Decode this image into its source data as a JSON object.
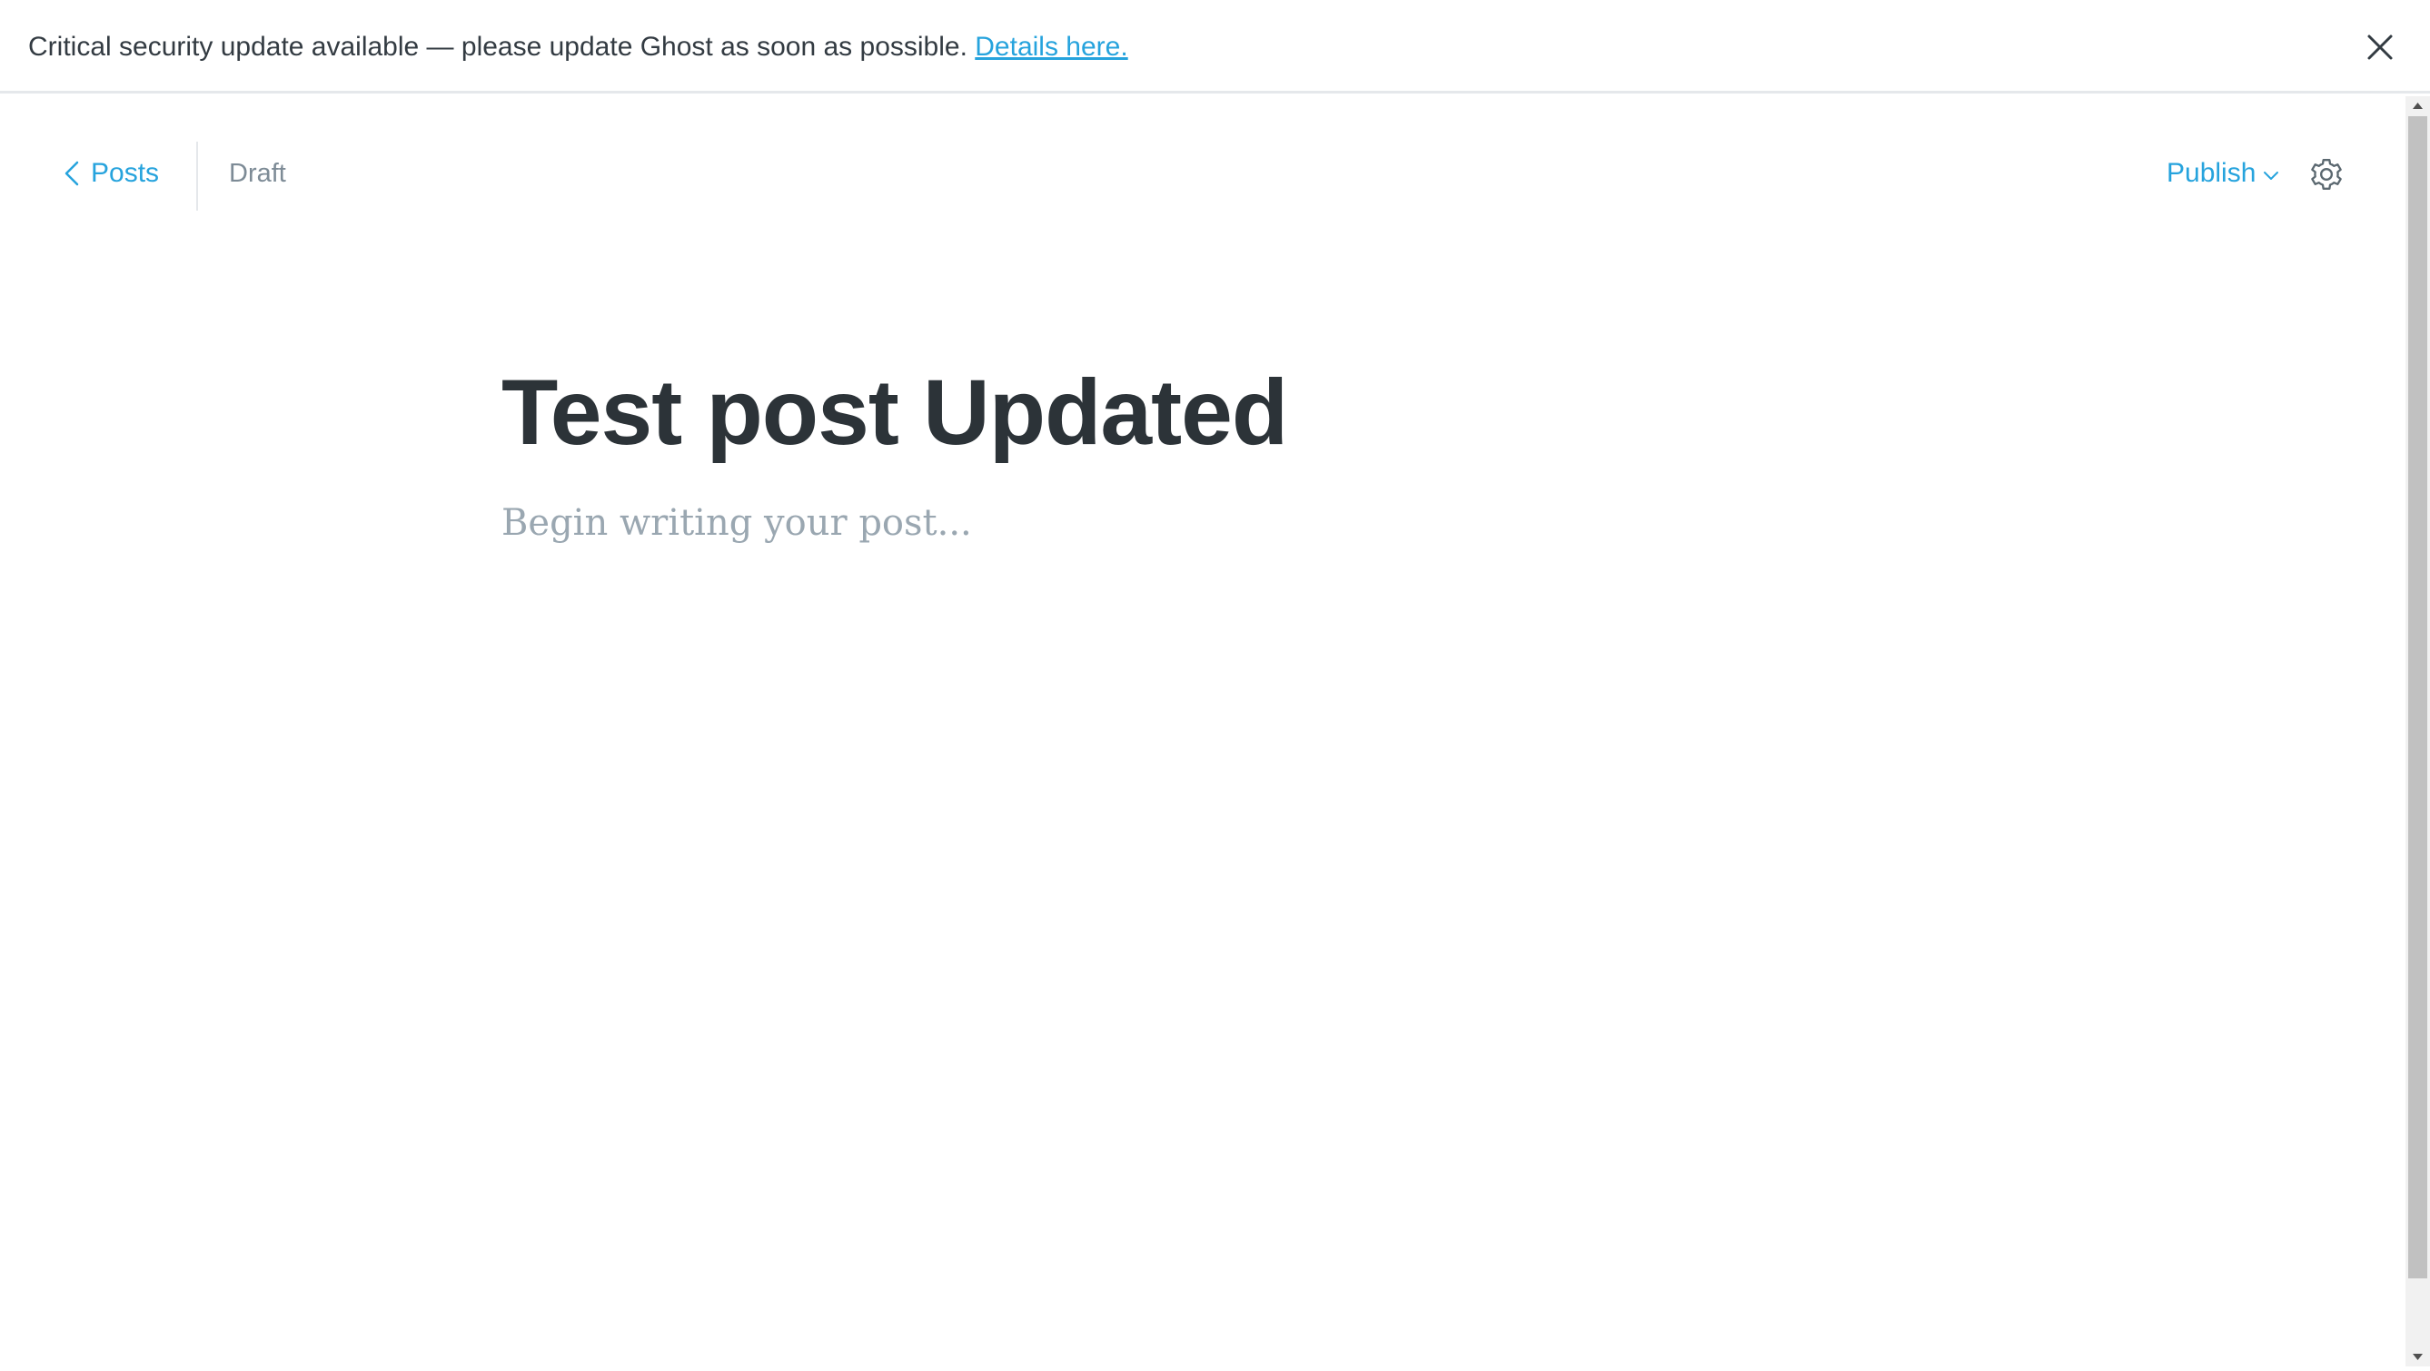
{
  "banner": {
    "message": "Critical security update available — please update Ghost as soon as possible. ",
    "link_label": "Details here.",
    "close_icon": "close-icon"
  },
  "toolbar": {
    "back_label": "Posts",
    "back_icon": "chevron-left-icon",
    "status": "Draft",
    "publish_label": "Publish",
    "publish_icon": "chevron-down-icon",
    "settings_icon": "gear-icon"
  },
  "post": {
    "title": "Test post Updated",
    "body_placeholder": "Begin writing your post..."
  },
  "colors": {
    "accent": "#26a3dd",
    "title_text": "#2c3338",
    "muted_text": "#7d8b96",
    "placeholder_text": "#9aa7b1"
  }
}
